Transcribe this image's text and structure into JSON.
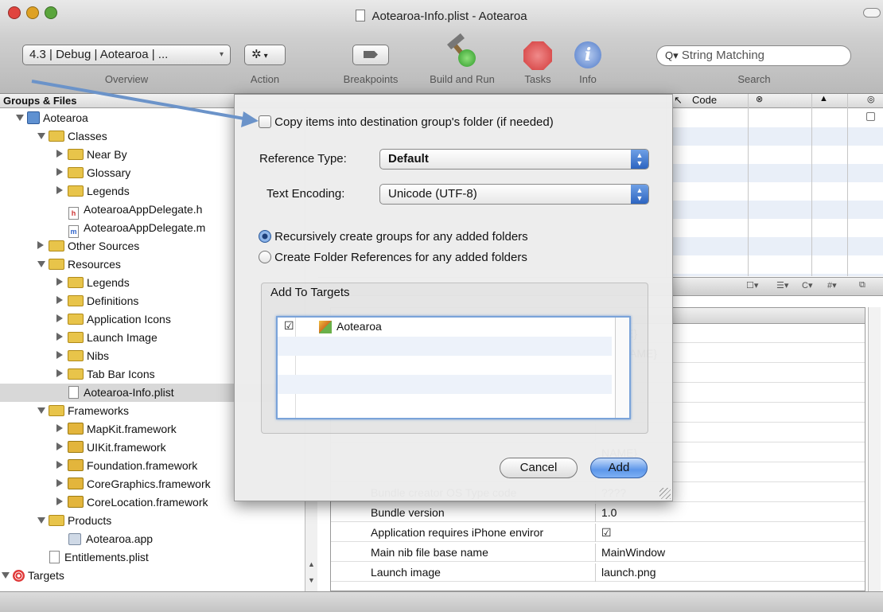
{
  "window": {
    "title": "Aotearoa-Info.plist - Aotearoa",
    "traffic_colors": {
      "close": "#e0443e",
      "minimize": "#dea123",
      "zoom": "#5aa53c"
    }
  },
  "toolbar": {
    "overview_value": "4.3 | Debug | Aotearoa | ...",
    "overview_label": "Overview",
    "action_label": "Action",
    "breakpoints_label": "Breakpoints",
    "build_run_label": "Build and Run",
    "tasks_label": "Tasks",
    "info_label": "Info",
    "search_placeholder": "String Matching",
    "search_label": "Search"
  },
  "groups": {
    "header": "Groups & Files",
    "items": [
      {
        "label": "Aotearoa",
        "icon": "project-icon",
        "disclosure": "open"
      },
      {
        "label": "Classes",
        "icon": "folder-icon",
        "disclosure": "open"
      },
      {
        "label": "Near By",
        "icon": "folder-icon",
        "disclosure": "closed"
      },
      {
        "label": "Glossary",
        "icon": "folder-icon",
        "disclosure": "closed"
      },
      {
        "label": "Legends",
        "icon": "folder-icon",
        "disclosure": "closed"
      },
      {
        "label": "AotearoaAppDelegate.h",
        "icon": "header-file-icon",
        "badge": "h"
      },
      {
        "label": "AotearoaAppDelegate.m",
        "icon": "source-file-icon",
        "badge": "m"
      },
      {
        "label": "Other Sources",
        "icon": "folder-icon",
        "disclosure": "closed"
      },
      {
        "label": "Resources",
        "icon": "folder-icon",
        "disclosure": "open"
      },
      {
        "label": "Legends",
        "icon": "folder-icon",
        "disclosure": "closed"
      },
      {
        "label": "Definitions",
        "icon": "folder-icon",
        "disclosure": "closed"
      },
      {
        "label": "Application Icons",
        "icon": "folder-icon",
        "disclosure": "closed"
      },
      {
        "label": "Launch Image",
        "icon": "folder-icon",
        "disclosure": "closed"
      },
      {
        "label": "Nibs",
        "icon": "folder-icon",
        "disclosure": "closed"
      },
      {
        "label": "Tab Bar Icons",
        "icon": "folder-icon",
        "disclosure": "closed"
      },
      {
        "label": "Aotearoa-Info.plist",
        "icon": "plist-file-icon"
      },
      {
        "label": "Frameworks",
        "icon": "folder-icon",
        "disclosure": "open"
      },
      {
        "label": "MapKit.framework",
        "icon": "framework-icon",
        "disclosure": "closed"
      },
      {
        "label": "UIKit.framework",
        "icon": "framework-icon",
        "disclosure": "closed"
      },
      {
        "label": "Foundation.framework",
        "icon": "framework-icon",
        "disclosure": "closed"
      },
      {
        "label": "CoreGraphics.framework",
        "icon": "framework-icon",
        "disclosure": "closed"
      },
      {
        "label": "CoreLocation.framework",
        "icon": "framework-icon",
        "disclosure": "closed"
      },
      {
        "label": "Products",
        "icon": "folder-icon",
        "disclosure": "open"
      },
      {
        "label": "Aotearoa.app",
        "icon": "app-icon"
      },
      {
        "label": "Entitlements.plist",
        "icon": "plist-file-icon"
      },
      {
        "label": "Targets",
        "icon": "target-icon",
        "disclosure": "open"
      }
    ]
  },
  "file_list": {
    "col_code": "Code"
  },
  "plist": {
    "rows": [
      {
        "key": "",
        "value": "NAME}"
      },
      {
        "key": "",
        "value": "LE_NAME}"
      },
      {
        "key": "",
        "value": ""
      },
      {
        "key": "",
        "value": ""
      },
      {
        "key": "",
        "value": ""
      },
      {
        "key": "",
        "value": ""
      },
      {
        "key": "",
        "value": "NAME}"
      },
      {
        "key": "",
        "value": ""
      },
      {
        "key": "Bundle creator OS Type code",
        "value": "????"
      },
      {
        "key": "Bundle version",
        "value": "1.0"
      },
      {
        "key": "Application requires iPhone enviror",
        "value": "☑"
      },
      {
        "key": "Main nib file base name",
        "value": "MainWindow"
      },
      {
        "key": "Launch image",
        "value": "launch.png"
      }
    ]
  },
  "dialog": {
    "copy_items_label": "Copy items into destination group's folder (if needed)",
    "copy_items_checked": false,
    "reference_type_label": "Reference Type:",
    "reference_type_value": "Default",
    "text_encoding_label": "Text Encoding:",
    "text_encoding_value": "Unicode (UTF-8)",
    "radio_recursive_label": "Recursively create groups for any added folders",
    "radio_recursive_selected": true,
    "radio_folder_refs_label": "Create Folder References for any added folders",
    "add_to_targets_label": "Add To Targets",
    "targets": [
      {
        "name": "Aotearoa",
        "checked": true
      }
    ],
    "cancel_label": "Cancel",
    "add_label": "Add"
  },
  "callout_color": "#6b93c9"
}
